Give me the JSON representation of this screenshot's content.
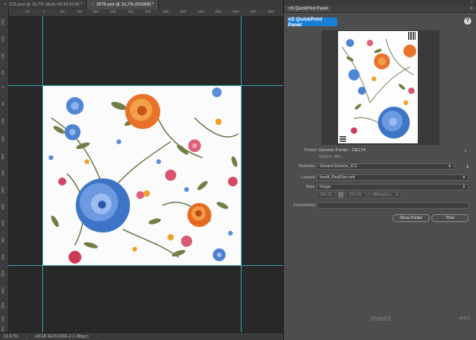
{
  "document_tabs": [
    {
      "label": "215.psd @ 16,7% (Auto-60,54,51/8) *",
      "active": false
    },
    {
      "label": "2878.psd @ 16,7% (RGB/8) *",
      "active": true
    }
  ],
  "rulers": {
    "top": [
      "50",
      "0",
      "50",
      "100",
      "150",
      "200",
      "250",
      "300",
      "350",
      "400",
      "450",
      "500",
      "550",
      "600",
      "650"
    ],
    "left": [
      "200",
      "150",
      "100",
      "50",
      "0",
      "50",
      "100",
      "150",
      "200",
      "250",
      "300",
      "350",
      "400",
      "450",
      "500",
      "550",
      "600",
      "650",
      "700",
      "750"
    ]
  },
  "status_bar": {
    "zoom": "16,67%",
    "profile": "sRGB IEC61966-2.1 (8bpc)"
  },
  "panel": {
    "title": "nS QuickPrint Panel",
    "logo_text": "nS QuickPrint Panel",
    "help_symbol": "?",
    "printer_label": "Printer:",
    "printer_name": "Generic Printer - DELTA",
    "printer_status": "Status: Idle",
    "scheme_label": "Scheme:",
    "scheme_value": "GenericScheme_ICC",
    "layout_label": "Layout:",
    "layout_value": "Inedit_RealSize.xml",
    "size_label": "Size:",
    "size_value": "Image",
    "width_value": "384.25",
    "height_value": "333.46",
    "unit_value": "Millimeters",
    "comments_label": "Comments:",
    "show_printer_label": "Show Printer",
    "print_label": "Print",
    "brand": "inèdit",
    "version": "v8.0.0"
  },
  "colors": {
    "guide": "#37b3c6",
    "logo_bg": "#1b7fd4",
    "panel_bg": "#4d4d4d",
    "canvas_bg": "#282828"
  }
}
